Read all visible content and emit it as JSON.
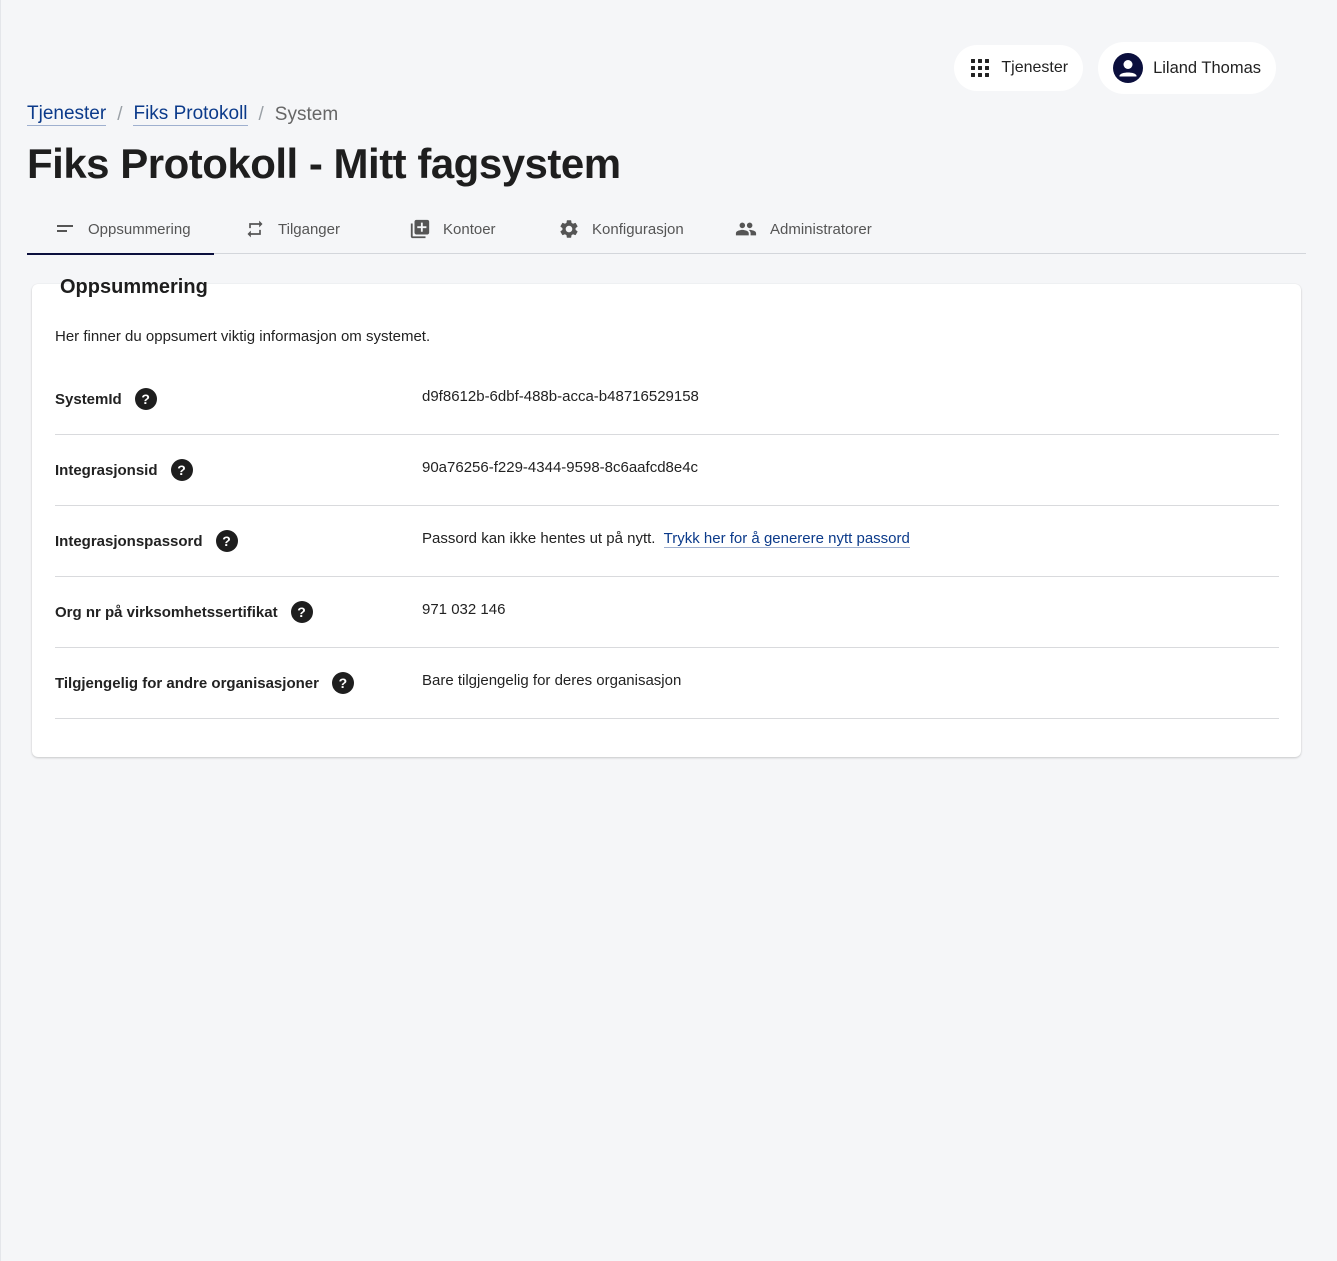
{
  "header": {
    "services_label": "Tjenester",
    "user_name": "Liland Thomas"
  },
  "breadcrumb": {
    "items": [
      "Tjenester",
      "Fiks Protokoll"
    ],
    "current": "System"
  },
  "page_title": "Fiks Protokoll - Mitt fagsystem",
  "tabs": [
    {
      "label": "Oppsummering",
      "icon": "summary-icon",
      "active": true
    },
    {
      "label": "Tilganger",
      "icon": "repeat-icon",
      "active": false
    },
    {
      "label": "Kontoer",
      "icon": "library-add-icon",
      "active": false
    },
    {
      "label": "Konfigurasjon",
      "icon": "gear-icon",
      "active": false
    },
    {
      "label": "Administratorer",
      "icon": "people-icon",
      "active": false
    }
  ],
  "summary": {
    "title": "Oppsummering",
    "description": "Her finner du oppsumert viktig informasjon om systemet.",
    "rows": [
      {
        "label": "SystemId",
        "value": "d9f8612b-6dbf-488b-acca-b48716529158"
      },
      {
        "label": "Integrasjonsid",
        "value": "90a76256-f229-4344-9598-8c6aafcd8e4c"
      },
      {
        "label": "Integrasjonspassord",
        "value": "Passord kan ikke hentes ut på nytt.",
        "link": "Trykk her for å generere nytt passord"
      },
      {
        "label": "Org nr på virksomhetssertifikat",
        "value": "971 032 146"
      },
      {
        "label": "Tilgjengelig for andre organisasjoner",
        "value": "Bare tilgjengelig for deres organisasjon"
      }
    ],
    "help_glyph": "?"
  },
  "colors": {
    "background": "#f5f6f8",
    "link": "#0b3a8a",
    "accent": "#0b0f3d"
  }
}
